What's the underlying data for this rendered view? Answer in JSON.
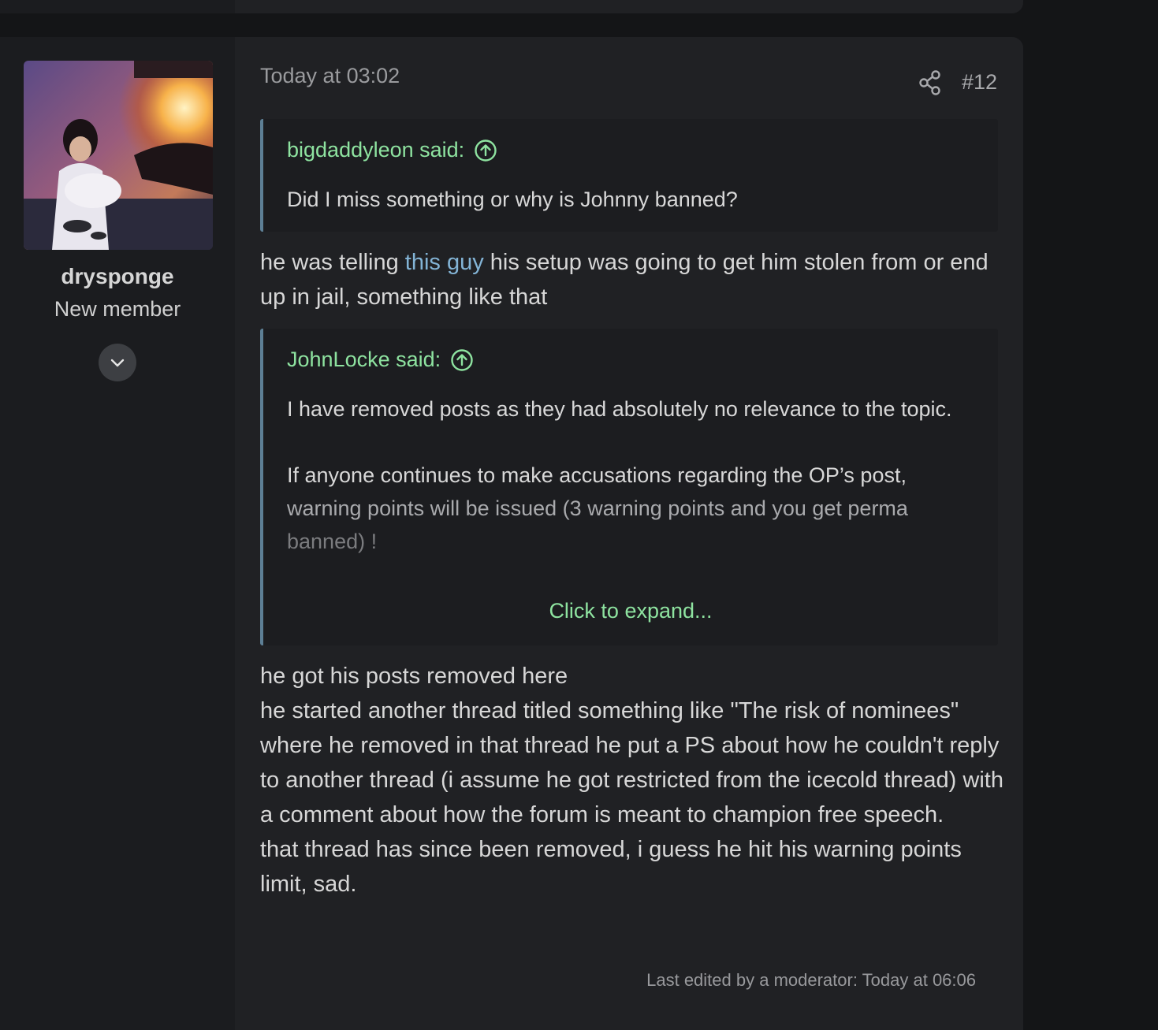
{
  "post": {
    "date": "Today at 03:02",
    "number": "#12",
    "author": {
      "username": "drysponge",
      "title": "New member"
    },
    "quote1": {
      "attribution": "bigdaddyleon said:",
      "text": "Did I miss something or why is Johnny banned?"
    },
    "reply1": {
      "before_link": "he was telling ",
      "link_text": "this guy",
      "after_link": " his setup was going to get him stolen from or end up in jail, something like that"
    },
    "quote2": {
      "attribution": "JohnLocke said:",
      "paragraph1": "I have removed posts as they had absolutely no relevance to the topic.",
      "paragraph2_line1": "If anyone continues to make accusations regarding the OP’s post,",
      "paragraph2_line2": "warning points will be issued (3 warning points and you get perma",
      "paragraph2_line3": "banned) !",
      "expand_label": "Click to expand..."
    },
    "reply2": {
      "line1": "he got his posts removed here",
      "line2": "he started another thread titled something like \"The risk of nominees\" where he removed in that thread he put a PS about how he couldn't reply to another thread (i assume he got restricted from the icecold thread) with a comment about how the forum is meant to champion free speech.",
      "line3": "that thread has since been removed, i guess he hit his warning points limit, sad."
    },
    "edit_note": "Last edited by a moderator: Today at 06:06"
  },
  "icons": {
    "share": "share-icon",
    "quote_jump": "arrow-up-circle-icon",
    "expand_user": "chevron-down-icon"
  },
  "colors": {
    "background": "#141517",
    "post_main": "#202124",
    "quote_accent": "#8ee3a0",
    "link": "#83b4d6",
    "quote_border": "#5d7f95"
  }
}
